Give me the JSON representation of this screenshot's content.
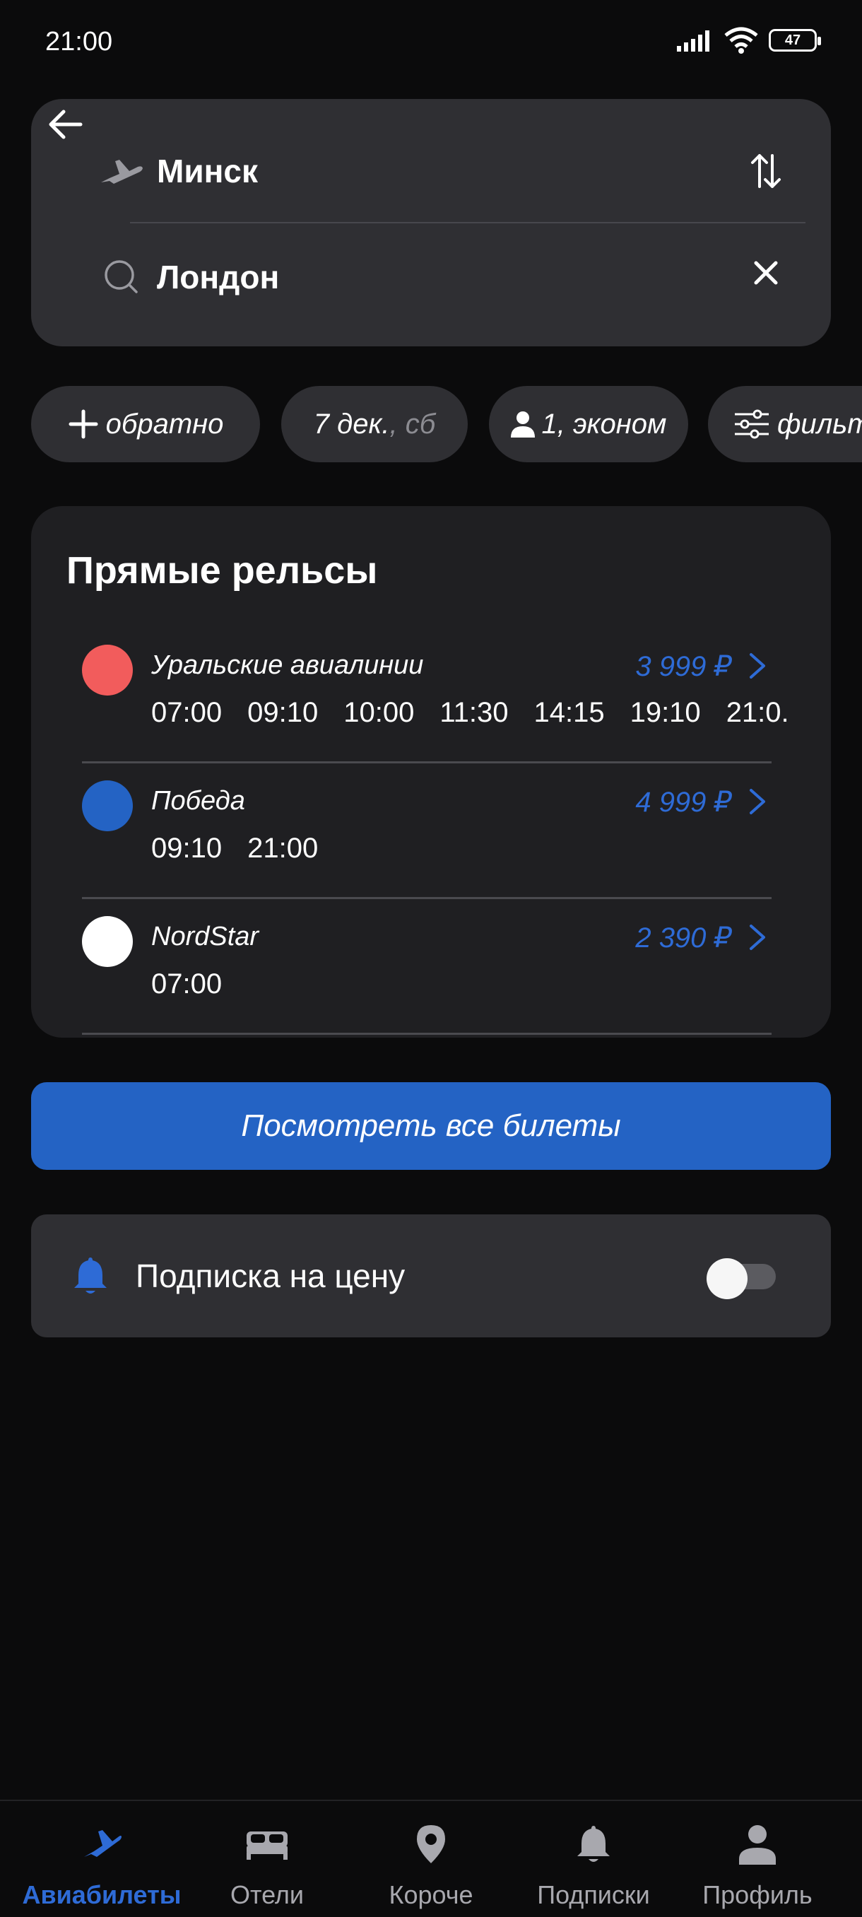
{
  "status_bar": {
    "time": "21:00",
    "battery": "47"
  },
  "search": {
    "from": "Минск",
    "to": "Лондон"
  },
  "chips": {
    "return": "обратно",
    "date_main": "7 дек.",
    "date_weekday": ", сб",
    "passengers": "1, эконом",
    "filters": "фильтры"
  },
  "direct": {
    "title": "Прямые рельсы",
    "airlines": [
      {
        "name": "Уральские авиалинии",
        "price": "3 999 ₽",
        "color": "#f25c5c",
        "times": [
          "07:00",
          "09:10",
          "10:00",
          "11:30",
          "14:15",
          "19:10",
          "21:0..."
        ]
      },
      {
        "name": "Победа",
        "price": "4 999 ₽",
        "color": "#2463c4",
        "times": [
          "09:10",
          "21:00"
        ]
      },
      {
        "name": "NordStar",
        "price": "2 390 ₽",
        "color": "#ffffff",
        "times": [
          "07:00"
        ]
      }
    ]
  },
  "all_tickets_button": "Посмотреть все билеты",
  "subscription": {
    "label": "Подписка на цену",
    "enabled": false
  },
  "bottom_nav": {
    "items": [
      {
        "label": "Авиабилеты",
        "icon": "plane-icon",
        "active": true
      },
      {
        "label": "Отели",
        "icon": "bed-icon",
        "active": false
      },
      {
        "label": "Короче",
        "icon": "map-pin-icon",
        "active": false
      },
      {
        "label": "Подписки",
        "icon": "bell-icon",
        "active": false
      },
      {
        "label": "Профиль",
        "icon": "user-icon",
        "active": false
      }
    ]
  },
  "colors": {
    "accent": "#2e6bd6",
    "button": "#2463c4",
    "card": "#2f2f33",
    "background": "#0b0b0c"
  }
}
